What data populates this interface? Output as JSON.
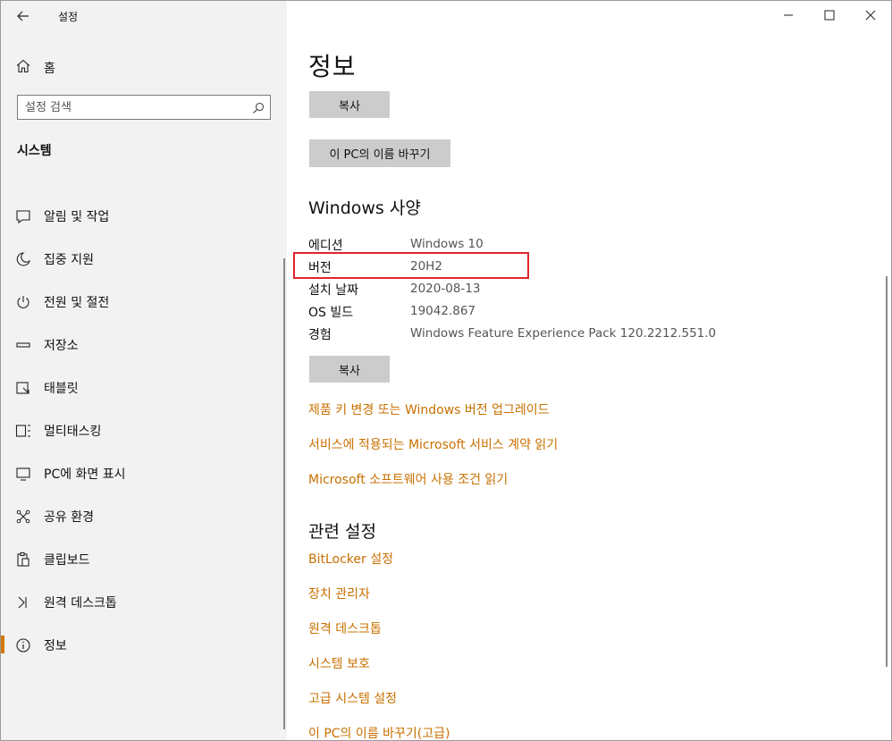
{
  "titlebar": {
    "back_icon": "back-arrow-icon",
    "title": "설정"
  },
  "window_controls": {
    "minimize_icon": "minimize-icon",
    "maximize_icon": "maximize-icon",
    "close_icon": "close-icon"
  },
  "sidebar": {
    "home": {
      "icon": "home-icon",
      "label": "홈"
    },
    "search": {
      "placeholder": "설정 검색",
      "icon": "search-icon"
    },
    "section_title": "시스템",
    "items": [
      {
        "icon": "notification-icon",
        "label": "알림 및 작업"
      },
      {
        "icon": "moon-icon",
        "label": "집중 지원"
      },
      {
        "icon": "power-icon",
        "label": "전원 및 절전"
      },
      {
        "icon": "storage-icon",
        "label": "저장소"
      },
      {
        "icon": "tablet-icon",
        "label": "태블릿"
      },
      {
        "icon": "multitasking-icon",
        "label": "멀티태스킹"
      },
      {
        "icon": "projector-icon",
        "label": "PC에 화면 표시"
      },
      {
        "icon": "share-icon",
        "label": "공유 환경"
      },
      {
        "icon": "clipboard-icon",
        "label": "클립보드"
      },
      {
        "icon": "remote-desktop-icon",
        "label": "원격 데스크톱"
      },
      {
        "icon": "info-icon",
        "label": "정보",
        "active": true
      }
    ]
  },
  "main": {
    "title": "정보",
    "copy_button_top": "복사",
    "rename_button": "이 PC의 이름 바꾸기",
    "windows_spec": {
      "heading": "Windows 사양",
      "rows": [
        {
          "label": "에디션",
          "value": "Windows 10"
        },
        {
          "label": "버전",
          "value": "20H2"
        },
        {
          "label": "설치 날짜",
          "value": "2020-08-13"
        },
        {
          "label": "OS 빌드",
          "value": "19042.867"
        },
        {
          "label": "경험",
          "value": "Windows Feature Experience Pack 120.2212.551.0"
        }
      ],
      "copy_button": "복사"
    },
    "links": [
      "제품 키 변경 또는 Windows 버전 업그레이드",
      "서비스에 적용되는 Microsoft 서비스 계약 읽기",
      "Microsoft 소프트웨어 사용 조건 읽기"
    ],
    "related": {
      "heading": "관련 설정",
      "links": [
        "BitLocker 설정",
        "장치 관리자",
        "원격 데스크톱",
        "시스템 보호",
        "고급 시스템 설정",
        "이 PC의 이름 바꾸기(고급)"
      ]
    }
  },
  "colors": {
    "accent": "#c87000",
    "active_indicator": "#d47800",
    "highlight_box": "#e0252b"
  }
}
